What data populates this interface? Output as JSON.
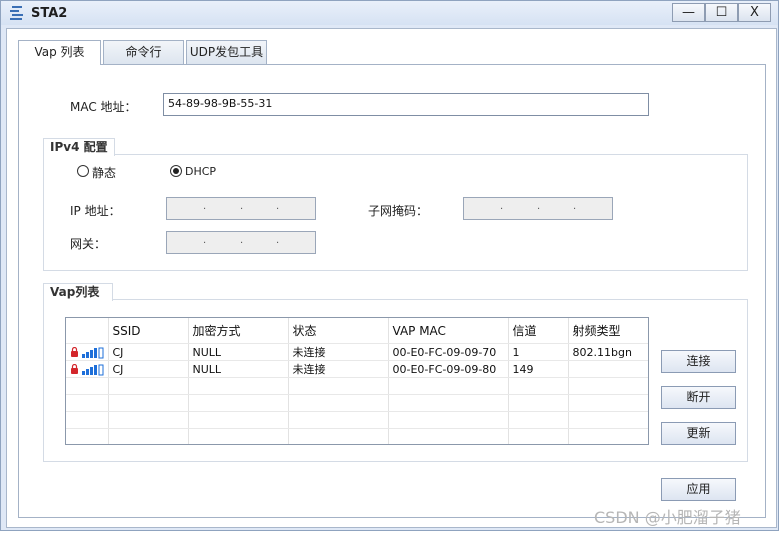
{
  "window": {
    "title": "STA2",
    "minimize_glyph": "—",
    "maximize_glyph": "☐",
    "close_glyph": "X"
  },
  "tabs": [
    {
      "label": "Vap 列表",
      "active": true
    },
    {
      "label": "命令行",
      "active": false
    },
    {
      "label": "UDP发包工具",
      "active": false
    }
  ],
  "mac": {
    "label": "MAC 地址：",
    "value": "54-89-98-9B-55-31"
  },
  "ipv4": {
    "title": "IPv4 配置",
    "static_label": "静态",
    "dhcp_label": "DHCP",
    "selected": "DHCP",
    "ip_label": "IP 地址：",
    "mask_label": "子网掩码：",
    "gateway_label": "网关："
  },
  "vap": {
    "title": "Vap列表",
    "columns": [
      "",
      "SSID",
      "加密方式",
      "状态",
      "VAP MAC",
      "信道",
      "射频类型"
    ],
    "rows": [
      {
        "icon": "lock-signal-icon",
        "ssid": "CJ",
        "encryption": "NULL",
        "status": "未连接",
        "mac": "00-E0-FC-09-09-70",
        "channel": "1",
        "radio": "802.11bgn"
      },
      {
        "icon": "lock-signal-icon",
        "ssid": "CJ",
        "encryption": "NULL",
        "status": "未连接",
        "mac": "00-E0-FC-09-09-80",
        "channel": "149",
        "radio": ""
      }
    ],
    "connect_label": "连接",
    "disconnect_label": "断开",
    "refresh_label": "更新"
  },
  "apply_label": "应用",
  "watermark": "CSDN @小肥溜子猪"
}
